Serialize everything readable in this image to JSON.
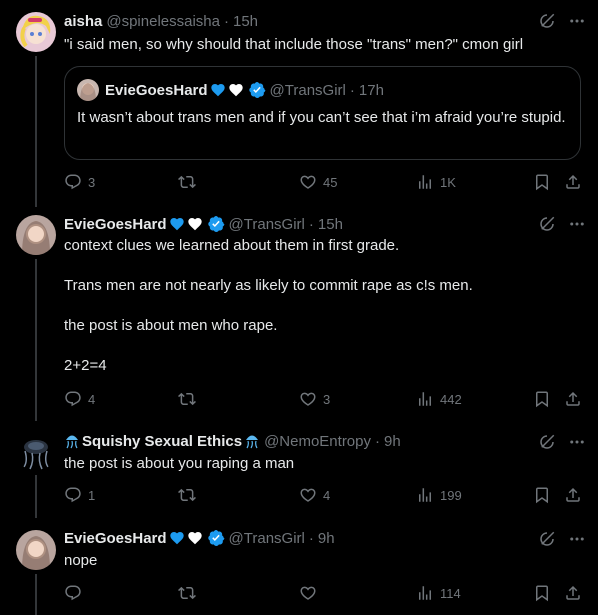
{
  "tweets": [
    {
      "name": "aisha",
      "handle": "@spinelessaisha",
      "time": "15h",
      "text": "\"i said men, so why should that include those \"trans\" men?\" cmon girl",
      "quote": {
        "name": "EvieGoesHard",
        "handle": "@TransGirl",
        "time": "17h",
        "text": "It wasn’t about trans men and if you can’t see that i’m afraid you’re stupid."
      },
      "actions": {
        "replies": "3",
        "reposts": "",
        "likes": "45",
        "views": "1K"
      }
    },
    {
      "name": "EvieGoesHard",
      "handle": "@TransGirl",
      "time": "15h",
      "lines": [
        "context clues we learned about them in first grade.",
        "Trans men are not nearly as likely to commit rape as c!s men.",
        "the post is about men who rape.",
        "2+2=4"
      ],
      "actions": {
        "replies": "4",
        "reposts": "",
        "likes": "3",
        "views": "442"
      }
    },
    {
      "name": "Squishy Sexual Ethics",
      "handle": "@NemoEntropy",
      "time": "9h",
      "text": "the post is about you raping a man",
      "actions": {
        "replies": "1",
        "reposts": "",
        "likes": "4",
        "views": "199"
      }
    },
    {
      "name": "EvieGoesHard",
      "handle": "@TransGirl",
      "time": "9h",
      "text": "nope",
      "actions": {
        "replies": "",
        "reposts": "",
        "likes": "",
        "views": "114"
      }
    }
  ],
  "colors": {
    "accent": "#1d9bf0",
    "muted": "#71767b",
    "heart_blue": "#1d9bf0",
    "heart_white": "#ffffff"
  },
  "icons": [
    "grok-icon",
    "more-icon",
    "reply-icon",
    "repost-icon",
    "like-icon",
    "views-icon",
    "bookmark-icon",
    "share-icon",
    "verified-icon",
    "blue-heart-icon",
    "white-heart-icon",
    "jellyfish-icon"
  ]
}
